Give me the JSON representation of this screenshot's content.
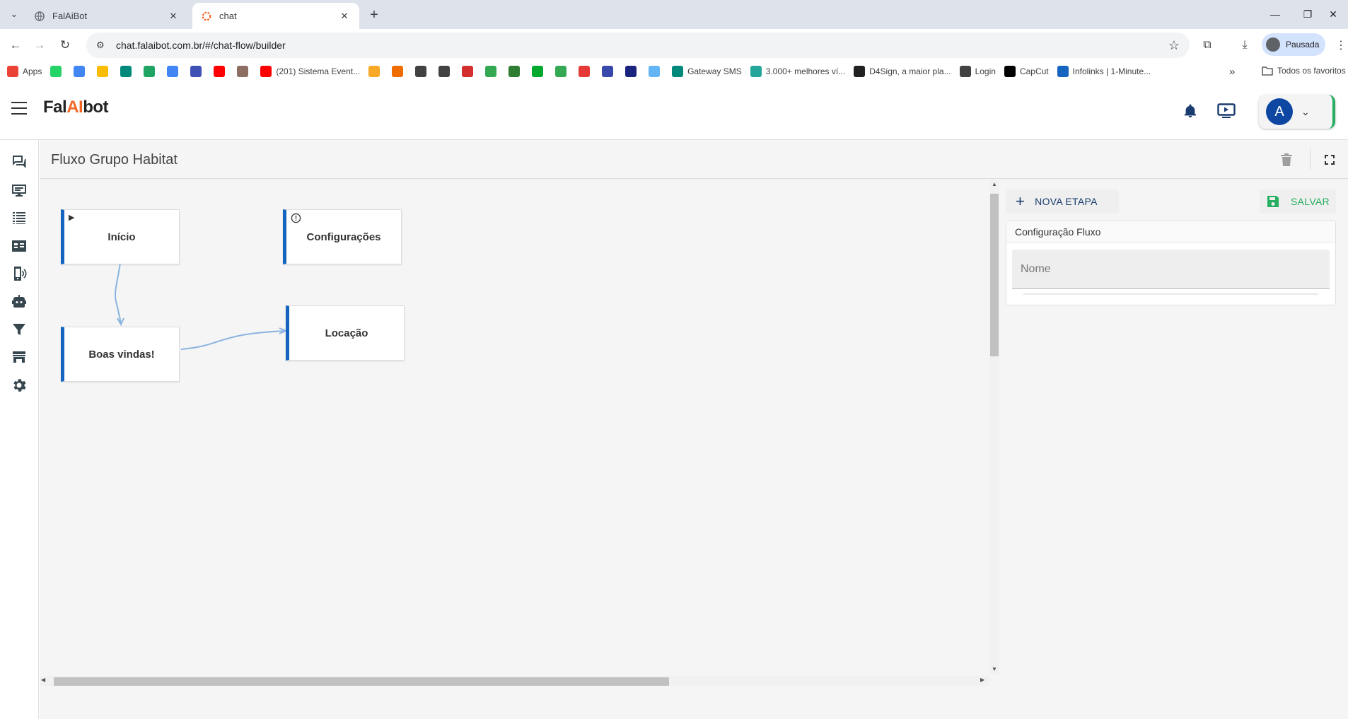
{
  "browser": {
    "tabs": [
      {
        "title": "FalAiBot",
        "active": false
      },
      {
        "title": "chat",
        "active": true
      }
    ],
    "url": "chat.falaibot.com.br/#/chat-flow/builder",
    "profile_label": "Pausada",
    "bookmarks": [
      {
        "label": "Apps",
        "icon": "apps-grid-icon",
        "color": "#ea4335"
      },
      {
        "label": "",
        "icon": "whatsapp-icon",
        "color": "#25d366"
      },
      {
        "label": "",
        "icon": "google-icon",
        "color": "#4285f4"
      },
      {
        "label": "",
        "icon": "keep-icon",
        "color": "#fbbc04"
      },
      {
        "label": "",
        "icon": "meet-icon",
        "color": "#00897b"
      },
      {
        "label": "",
        "icon": "drive-icon",
        "color": "#1fa463"
      },
      {
        "label": "",
        "icon": "calendar-icon",
        "color": "#4285f4"
      },
      {
        "label": "",
        "icon": "forms-icon",
        "color": "#3f51b5"
      },
      {
        "label": "",
        "icon": "youtube-icon",
        "color": "#ff0000"
      },
      {
        "label": "",
        "icon": "avatar-icon",
        "color": "#8d6e63"
      },
      {
        "label": "(201) Sistema Event...",
        "icon": "youtube-icon",
        "color": "#ff0000"
      },
      {
        "label": "",
        "icon": "calendar-orange-icon",
        "color": "#f9a825"
      },
      {
        "label": "",
        "icon": "rss-icon",
        "color": "#ef6c00"
      },
      {
        "label": "",
        "icon": "globe-icon",
        "color": "#424242"
      },
      {
        "label": "",
        "icon": "globe-icon",
        "color": "#424242"
      },
      {
        "label": "",
        "icon": "maps-pin-icon",
        "color": "#d32f2f"
      },
      {
        "label": "",
        "icon": "maps-icon",
        "color": "#34a853"
      },
      {
        "label": "",
        "icon": "feedly-icon",
        "color": "#2e7d32"
      },
      {
        "label": "",
        "icon": "evernote-icon",
        "color": "#00a82d"
      },
      {
        "label": "",
        "icon": "maps-pin-icon",
        "color": "#34a853"
      },
      {
        "label": "",
        "icon": "app-red-icon",
        "color": "#e53935"
      },
      {
        "label": "",
        "icon": "app-blue-icon",
        "color": "#3949ab"
      },
      {
        "label": "",
        "icon": "app-navy-icon",
        "color": "#1a237e"
      },
      {
        "label": "",
        "icon": "app-light-icon",
        "color": "#64b5f6"
      },
      {
        "label": "Gateway SMS",
        "icon": "envelope-icon",
        "color": "#00897b"
      },
      {
        "label": "3.000+ melhores ví...",
        "icon": "d-icon",
        "color": "#26a69a"
      },
      {
        "label": "D4Sign, a maior pla...",
        "icon": "pen-icon",
        "color": "#212121"
      },
      {
        "label": "Login",
        "icon": "globe-icon",
        "color": "#424242"
      },
      {
        "label": "CapCut",
        "icon": "capcut-icon",
        "color": "#000000"
      },
      {
        "label": "Infolinks | 1-Minute...",
        "icon": "infolinks-icon",
        "color": "#1565c0"
      }
    ],
    "favorites_label": "Todos os favoritos"
  },
  "app": {
    "logo": {
      "prefix": "Fal",
      "ai": "AI",
      "suffix": "bot"
    },
    "user_initial": "A",
    "page_title": "Fluxo Grupo Habitat",
    "sidebar_icons": [
      "chat-icon",
      "monitor-icon",
      "list-icon",
      "contact-card-icon",
      "phone-signal-icon",
      "robot-icon",
      "filter-icon",
      "store-icon",
      "settings-icon"
    ],
    "flow": {
      "nodes": [
        {
          "id": "inicio",
          "label": "Início",
          "badge": "play-icon"
        },
        {
          "id": "config",
          "label": "Configurações",
          "badge": "alert-icon"
        },
        {
          "id": "boas",
          "label": "Boas vindas!",
          "badge": ""
        },
        {
          "id": "locacao",
          "label": "Locação",
          "badge": ""
        }
      ],
      "edges": [
        {
          "from": "inicio",
          "to": "boas"
        },
        {
          "from": "boas",
          "to": "locacao"
        }
      ]
    },
    "panel": {
      "nova_etapa_label": "NOVA ETAPA",
      "salvar_label": "SALVAR",
      "config_title": "Configuração Fluxo",
      "name_placeholder": "Nome",
      "name_value": ""
    },
    "colors": {
      "node_accent": "#1565c0",
      "edge": "#8ab4e0",
      "save_green": "#27ae60",
      "logo_orange": "#f26522",
      "avatar_blue": "#0d47a1"
    }
  }
}
